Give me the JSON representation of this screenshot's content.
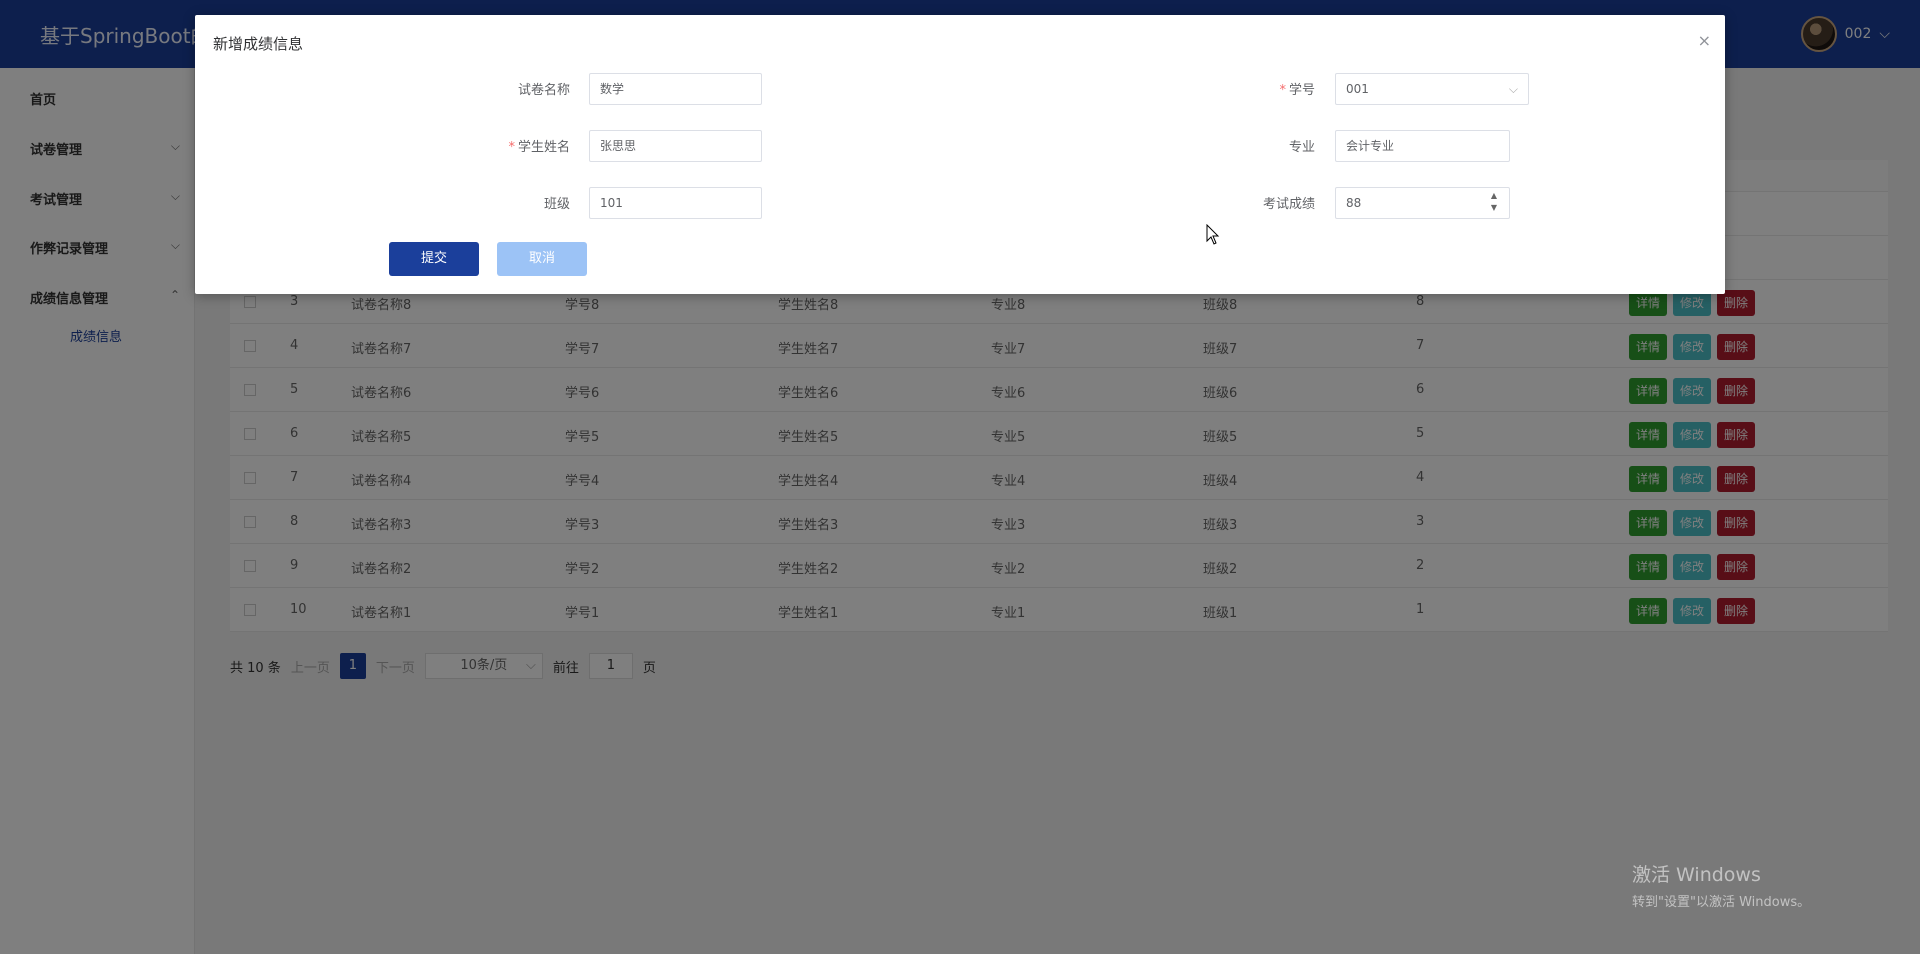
{
  "header": {
    "brand": "基于SpringBoot的",
    "user": "002",
    "user_chevron": "chevron-down-icon"
  },
  "sidebar": {
    "items": [
      {
        "label": "首页",
        "chevron": ""
      },
      {
        "label": "试卷管理",
        "chevron": "⌵"
      },
      {
        "label": "考试管理",
        "chevron": "⌵"
      },
      {
        "label": "作弊记录管理",
        "chevron": "⌵"
      },
      {
        "label": "成绩信息管理",
        "chevron": "⌃"
      }
    ],
    "sub_items": [
      {
        "label": "成绩信息"
      }
    ]
  },
  "table": {
    "rows": [
      {
        "id": "3",
        "paper": "试卷名称8",
        "sid": "学号8",
        "name": "学生姓名8",
        "major": "专业8",
        "cls": "班级8",
        "score": "8"
      },
      {
        "id": "4",
        "paper": "试卷名称7",
        "sid": "学号7",
        "name": "学生姓名7",
        "major": "专业7",
        "cls": "班级7",
        "score": "7"
      },
      {
        "id": "5",
        "paper": "试卷名称6",
        "sid": "学号6",
        "name": "学生姓名6",
        "major": "专业6",
        "cls": "班级6",
        "score": "6"
      },
      {
        "id": "6",
        "paper": "试卷名称5",
        "sid": "学号5",
        "name": "学生姓名5",
        "major": "专业5",
        "cls": "班级5",
        "score": "5"
      },
      {
        "id": "7",
        "paper": "试卷名称4",
        "sid": "学号4",
        "name": "学生姓名4",
        "major": "专业4",
        "cls": "班级4",
        "score": "4"
      },
      {
        "id": "8",
        "paper": "试卷名称3",
        "sid": "学号3",
        "name": "学生姓名3",
        "major": "专业3",
        "cls": "班级3",
        "score": "3"
      },
      {
        "id": "9",
        "paper": "试卷名称2",
        "sid": "学号2",
        "name": "学生姓名2",
        "major": "专业2",
        "cls": "班级2",
        "score": "2"
      },
      {
        "id": "10",
        "paper": "试卷名称1",
        "sid": "学号1",
        "name": "学生姓名1",
        "major": "专业1",
        "cls": "班级1",
        "score": "1"
      }
    ],
    "actions": {
      "detail": "详情",
      "edit": "修改",
      "delete": "删除"
    }
  },
  "pager": {
    "total": "共 10 条",
    "prev": "上一页",
    "current": "1",
    "next": "下一页",
    "page_size": "10条/页",
    "goto_label": "前往",
    "goto_value": "1",
    "page_suffix": "页"
  },
  "dialog": {
    "title": "新增成绩信息",
    "close": "×",
    "fields": {
      "paper_name": {
        "label": "试卷名称",
        "value": "数学",
        "required": false
      },
      "student_id": {
        "label": "学号",
        "value": "001",
        "required": true
      },
      "student_name": {
        "label": "学生姓名",
        "value": "张思思",
        "required": true
      },
      "major": {
        "label": "专业",
        "value": "会计专业",
        "required": false
      },
      "class": {
        "label": "班级",
        "value": "101",
        "required": false
      },
      "score": {
        "label": "考试成绩",
        "value": "88",
        "required": false
      }
    },
    "submit": "提交",
    "cancel": "取消"
  },
  "watermark": {
    "line1": "激活 Windows",
    "line2": "转到\"设置\"以激活 Windows。"
  }
}
